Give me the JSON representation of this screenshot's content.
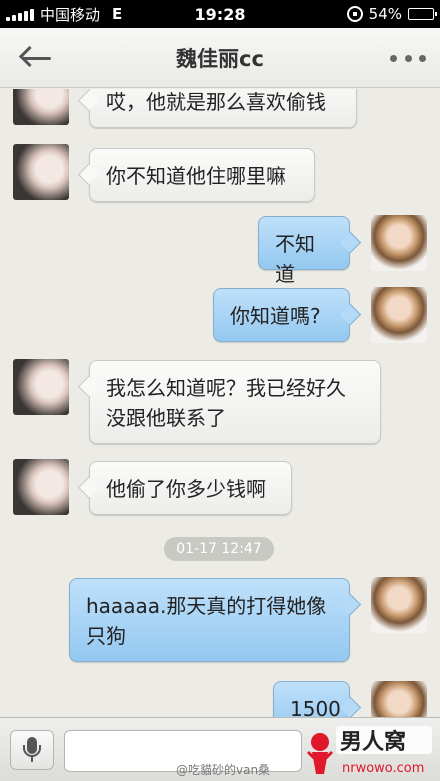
{
  "status_bar": {
    "carrier": "中国移动",
    "network": "E",
    "time": "19:28",
    "battery": "54%",
    "battery_level": 0.54
  },
  "header": {
    "title": "魏佳丽cc",
    "back_icon": "arrow-left-icon",
    "more_icon": "more-dots-icon"
  },
  "messages": [
    {
      "side": "left",
      "text": "哎，他就是那么喜欢偷钱"
    },
    {
      "side": "left",
      "text": "你不知道他住哪里嘛"
    },
    {
      "side": "right",
      "text": "不知道"
    },
    {
      "side": "right",
      "text": "你知道嗎?"
    },
    {
      "side": "left",
      "text": "我怎么知道呢？我已经好久没跟他联系了"
    },
    {
      "side": "left",
      "text": "他偷了你多少钱啊"
    },
    {
      "side": "right",
      "text": "haaaaa.那天真的打得她像只狗"
    },
    {
      "side": "right",
      "text": "1500"
    }
  ],
  "timestamp": "01-17 12:47",
  "input_bar": {
    "voice_icon": "microphone-icon",
    "watermark": "@吃貓砂的van桑"
  },
  "logo": {
    "name": "男人窝",
    "url_text": "nrwowo.com",
    "color": "#e0182b"
  }
}
